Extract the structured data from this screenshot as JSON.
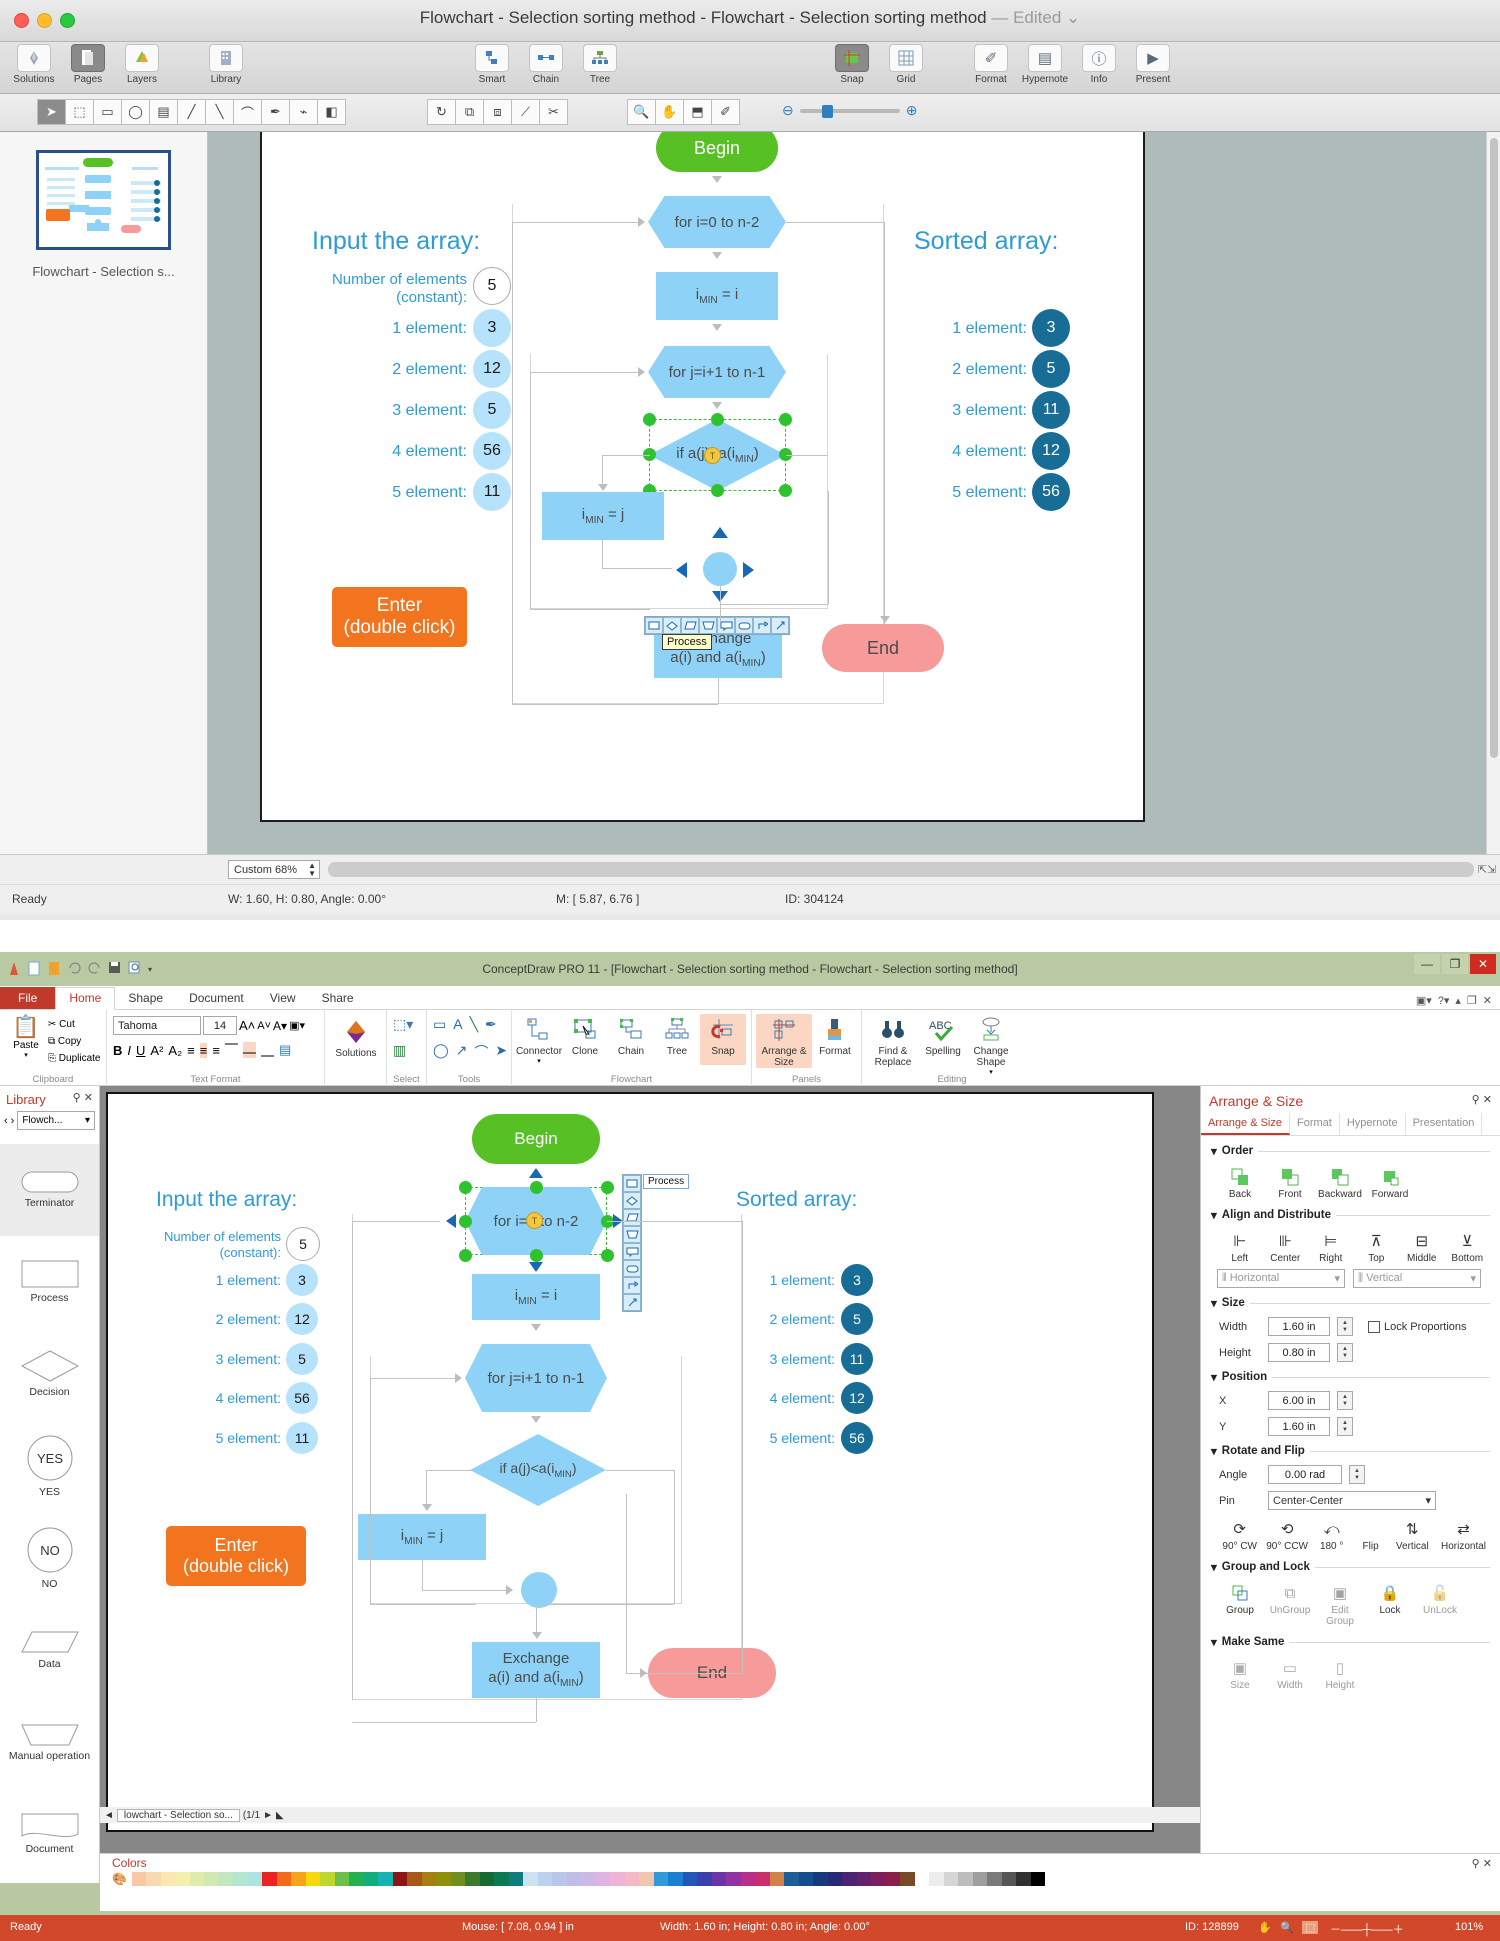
{
  "mac": {
    "title": "Flowchart - Selection sorting method - Flowchart - Selection sorting method",
    "title_dash": "—",
    "edited": "Edited",
    "toolbar_left": [
      {
        "label": "Solutions",
        "icon": "solutions-icon",
        "selected": false
      },
      {
        "label": "Pages",
        "icon": "pages-icon",
        "selected": true
      },
      {
        "label": "Layers",
        "icon": "layers-icon",
        "selected": false
      }
    ],
    "toolbar_library": [
      {
        "label": "Library",
        "icon": "library-icon",
        "selected": false
      }
    ],
    "toolbar_center": [
      {
        "label": "Smart",
        "icon": "smart-icon",
        "selected": false
      },
      {
        "label": "Chain",
        "icon": "chain-icon",
        "selected": false
      },
      {
        "label": "Tree",
        "icon": "tree-icon",
        "selected": false
      }
    ],
    "toolbar_snap": [
      {
        "label": "Snap",
        "icon": "snap-icon",
        "selected": true
      },
      {
        "label": "Grid",
        "icon": "grid-icon",
        "selected": false
      }
    ],
    "toolbar_right": [
      {
        "label": "Format",
        "icon": "format-icon",
        "selected": false
      },
      {
        "label": "Hypernote",
        "icon": "hypernote-icon",
        "selected": false
      },
      {
        "label": "Info",
        "icon": "info-icon",
        "selected": false
      },
      {
        "label": "Present",
        "icon": "present-icon",
        "selected": false
      }
    ],
    "tools_group1": [
      "pointer-icon",
      "text-select-icon",
      "rectangle-icon",
      "ellipse-icon",
      "table-icon",
      "line-icon",
      "diagonal-icon",
      "curve-icon",
      "pen-icon",
      "polyline-icon",
      "door-icon"
    ],
    "tools_group2": [
      "rotate-icon",
      "align-icon",
      "distribute-icon",
      "connector-add-icon",
      "scissors-icon"
    ],
    "tools_group3": [
      "zoom-icon",
      "hand-icon",
      "stamp-icon",
      "eyedropper-icon"
    ],
    "zoom_out_icon": "zoom-out-icon",
    "zoom_in_icon": "zoom-in-icon",
    "sidebar": {
      "page_title": "Flowchart - Selection s..."
    },
    "status": {
      "zoom": "Custom 68%",
      "ready": "Ready",
      "dims": "W: 1.60,  H: 0.80,  Angle: 0.00°",
      "mouse": "M: [ 5.87, 6.76 ]",
      "id": "ID: 304124"
    },
    "canvas": {
      "left_heading": "Input the array:",
      "right_heading": "Sorted array:",
      "const_label_l1": "Number of elements",
      "const_label_l2": "(constant):",
      "const_value": "5",
      "input_rows": [
        {
          "label": "1 element:",
          "value": "3"
        },
        {
          "label": "2 element:",
          "value": "12"
        },
        {
          "label": "3 element:",
          "value": "5"
        },
        {
          "label": "4 element:",
          "value": "56"
        },
        {
          "label": "5 element:",
          "value": "11"
        }
      ],
      "sorted_rows": [
        {
          "label": "1 element:",
          "value": "3"
        },
        {
          "label": "2 element:",
          "value": "5"
        },
        {
          "label": "3 element:",
          "value": "11"
        },
        {
          "label": "4 element:",
          "value": "12"
        },
        {
          "label": "5 element:",
          "value": "56"
        }
      ],
      "enter_l1": "Enter",
      "enter_l2": "(double click)",
      "n_begin": "Begin",
      "n_for_i": "for i=0 to n-2",
      "n_imin_i_a": "i",
      "n_imin_i_b": "MIN",
      "n_imin_i_c": " = i",
      "n_for_j": "for j=i+1 to n-1",
      "n_if_a": "if a(j)<a(i",
      "n_if_b": "MIN",
      "n_if_c": ")",
      "n_imin_j_a": "i",
      "n_imin_j_b": "MIN",
      "n_imin_j_c": " = j",
      "n_exchange_1": "Exchange",
      "n_exchange_2a": "a(i) and a(i",
      "n_exchange_2b": "MIN",
      "n_exchange_2c": ")",
      "n_end": "End",
      "shape_palette": [
        "process-shape-icon",
        "decision-shape-icon",
        "data-shape-icon",
        "manual-op-shape-icon",
        "callout-shape-icon",
        "terminator-shape-icon",
        "connector-elbow-icon",
        "connector-arrow-icon"
      ],
      "tooltip": "Process"
    }
  },
  "win": {
    "title": "ConceptDraw PRO 11 - [Flowchart - Selection sorting method - Flowchart - Selection sorting method]",
    "quick_access": [
      "app-icon",
      "new-icon",
      "open-icon",
      "undo-icon",
      "redo-icon",
      "save-icon",
      "print-preview-icon",
      "qat-dropdown-icon"
    ],
    "window_buttons": [
      "minimize-icon",
      "restore-icon",
      "close-icon"
    ],
    "tabs": [
      {
        "label": "File",
        "kind": "file"
      },
      {
        "label": "Home",
        "kind": "active"
      },
      {
        "label": "Shape",
        "kind": "normal"
      },
      {
        "label": "Document",
        "kind": "normal"
      },
      {
        "label": "View",
        "kind": "normal"
      },
      {
        "label": "Share",
        "kind": "normal"
      }
    ],
    "ribbon_right_icons": [
      "window-layout-icon",
      "help-icon",
      "minimize-ribbon-icon",
      "restore-doc-icon",
      "close-doc-icon"
    ],
    "groups": {
      "clipboard": {
        "name": "Clipboard",
        "paste": "Paste",
        "items": [
          "Cut",
          "Copy",
          "Duplicate"
        ]
      },
      "text_format": {
        "name": "Text Format",
        "font": "Tahoma",
        "size": "14",
        "buttons": [
          "grow-font-icon",
          "shrink-font-icon",
          "font-color-icon",
          "highlight-icon",
          "bold-icon",
          "italic-icon",
          "underline-icon",
          "superscript-icon",
          "subscript-icon",
          "align-left-icon",
          "align-center-icon",
          "align-right-icon",
          "align-top-icon",
          "align-middle-icon",
          "align-bottom-icon",
          "text-block-icon"
        ]
      },
      "solutions": {
        "name": "",
        "label": "Solutions",
        "icon": "solutions-diamond-icon"
      },
      "select": {
        "name": "Select",
        "icons": [
          "select-area-icon",
          "select-all-icon"
        ]
      },
      "tools": {
        "name": "Tools",
        "icons": [
          "rect-tool-icon",
          "text-tool-icon",
          "line-tool-icon",
          "pen-tool-icon",
          "ellipse-tool-icon",
          "arrow-tool-icon",
          "curve-tool-icon",
          "pointer-tool-icon"
        ]
      },
      "flowchart": {
        "name": "Flowchart",
        "items": [
          {
            "label": "Connector",
            "icon": "connector-icon",
            "hl": false
          },
          {
            "label": "Clone",
            "icon": "clone-icon",
            "hl": false
          },
          {
            "label": "Chain",
            "icon": "chain-icon",
            "hl": false
          },
          {
            "label": "Tree",
            "icon": "tree-icon",
            "hl": false
          },
          {
            "label": "Snap",
            "icon": "snap-icon",
            "hl": true
          }
        ]
      },
      "panels": {
        "name": "Panels",
        "items": [
          {
            "label": "Arrange & Size",
            "icon": "arrange-size-icon",
            "hl": true
          },
          {
            "label": "Format",
            "icon": "format-brush-icon",
            "hl": false
          }
        ]
      },
      "editing": {
        "name": "Editing",
        "items": [
          {
            "label": "Find & Replace",
            "icon": "find-replace-icon",
            "hl": false
          },
          {
            "label": "Spelling",
            "icon": "spelling-icon",
            "hl": false
          },
          {
            "label": "Change Shape",
            "icon": "change-shape-icon",
            "hl": false
          }
        ]
      }
    },
    "library": {
      "title": "Library",
      "pin_icon": "pin-icon",
      "close_icon": "close-icon",
      "prev_icon": "prev-icon",
      "next_icon": "next-icon",
      "dropdown": "Flowch...",
      "items": [
        {
          "name": "Terminator",
          "shape": "terminator",
          "selected": true
        },
        {
          "name": "Process",
          "shape": "process",
          "selected": false
        },
        {
          "name": "Decision",
          "shape": "decision",
          "selected": false
        },
        {
          "name": "YES",
          "shape": "circle",
          "text": "YES",
          "selected": false
        },
        {
          "name": "NO",
          "shape": "circle",
          "text": "NO",
          "selected": false
        },
        {
          "name": "Data",
          "shape": "data",
          "selected": false
        },
        {
          "name": "Manual operation",
          "shape": "manual",
          "selected": false
        },
        {
          "name": "Document",
          "shape": "document",
          "selected": false
        }
      ]
    },
    "arrange": {
      "title": "Arrange & Size",
      "pin_icon": "pin-icon",
      "close_icon": "close-icon",
      "tabs": [
        "Arrange & Size",
        "Format",
        "Hypernote",
        "Presentation"
      ],
      "order": {
        "title": "Order",
        "items": [
          "Back",
          "Front",
          "Backward",
          "Forward"
        ]
      },
      "align": {
        "title": "Align and Distribute",
        "items": [
          "Left",
          "Center",
          "Right",
          "Top",
          "Middle",
          "Bottom"
        ],
        "horizontal": "Horizontal",
        "vertical": "Vertical"
      },
      "size": {
        "title": "Size",
        "width_label": "Width",
        "width_value": "1.60 in",
        "height_label": "Height",
        "height_value": "0.80 in",
        "lock_label": "Lock Proportions"
      },
      "position": {
        "title": "Position",
        "x_label": "X",
        "x_value": "6.00 in",
        "y_label": "Y",
        "y_value": "1.60 in"
      },
      "rotate": {
        "title": "Rotate and Flip",
        "angle_label": "Angle",
        "angle_value": "0.00 rad",
        "pin_label": "Pin",
        "pin_value": "Center-Center",
        "items": [
          "90° CW",
          "90° CCW",
          "180 °"
        ],
        "flip_label": "Flip",
        "flip_items": [
          "Vertical",
          "Horizontal"
        ]
      },
      "group": {
        "title": "Group and Lock",
        "items": [
          "Group",
          "UnGroup",
          "Edit Group",
          "Lock",
          "UnLock"
        ]
      },
      "same": {
        "title": "Make Same",
        "items": [
          "Size",
          "Width",
          "Height"
        ]
      }
    },
    "colors_panel": {
      "title": "Colors",
      "pin_icon": "pin-icon",
      "close_icon": "close-icon"
    },
    "doc_tab": "lowchart - Selection so...",
    "doc_page": "(1/1",
    "status": {
      "ready": "Ready",
      "mouse": "Mouse: [ 7.08, 0.94 ] in",
      "dims": "Width: 1.60 in; Height: 0.80 in; Angle: 0.00°",
      "id": "ID: 128899",
      "zoom": "101%"
    },
    "canvas": {
      "left_heading": "Input the array:",
      "right_heading": "Sorted array:",
      "const_label_l1": "Number of elements",
      "const_label_l2": "(constant):",
      "const_value": "5",
      "input_rows": [
        {
          "label": "1 element:",
          "value": "3"
        },
        {
          "label": "2 element:",
          "value": "12"
        },
        {
          "label": "3 element:",
          "value": "5"
        },
        {
          "label": "4 element:",
          "value": "56"
        },
        {
          "label": "5 element:",
          "value": "11"
        }
      ],
      "sorted_rows": [
        {
          "label": "1 element:",
          "value": "3"
        },
        {
          "label": "2 element:",
          "value": "5"
        },
        {
          "label": "3 element:",
          "value": "11"
        },
        {
          "label": "4 element:",
          "value": "12"
        },
        {
          "label": "5 element:",
          "value": "56"
        }
      ],
      "enter_l1": "Enter",
      "enter_l2": "(double click)",
      "n_begin": "Begin",
      "n_for_i": "for i=0 to n-2",
      "n_imin_i": "i",
      "n_imin_i_sub": "MIN",
      "n_imin_i_rest": " = i",
      "n_for_j": "for j=i+1 to n-1",
      "n_if_a": "if a(j)<a(i",
      "n_if_b": "MIN",
      "n_if_c": ")",
      "n_imin_j": "i",
      "n_imin_j_sub": "MIN",
      "n_imin_j_rest": " = j",
      "n_exchange_1": "Exchange",
      "n_exchange_2a": "a(i) and a(i",
      "n_exchange_2b": "MIN",
      "n_exchange_2c": ")",
      "n_end": "End",
      "shape_palette": [
        "process-shape-icon",
        "decision-shape-icon",
        "data-shape-icon",
        "manual-op-shape-icon",
        "callout-shape-icon",
        "terminator-shape-icon",
        "connector-elbow-icon",
        "connector-arrow-icon"
      ],
      "tooltip": "Process"
    }
  },
  "colors": {
    "accent_blue": "#2d9bd8",
    "shape_blue": "#8ed2f7",
    "begin_green": "#56c024",
    "end_pink": "#f79a9a",
    "enter_orange": "#f2741e",
    "dark_badge": "#186d96",
    "win_status_red": "#d1492a",
    "ribbon_highlight": "#fbd6c3"
  },
  "palette_swatches": [
    "#f8c9a4",
    "#fbd9b0",
    "#fbe8b0",
    "#f3f0ae",
    "#e0eda8",
    "#cfe9b0",
    "#bfe8c3",
    "#b4e6d4",
    "#aee3e3",
    "#ee2222",
    "#f36a1e",
    "#f7a41c",
    "#f5d90a",
    "#bed62e",
    "#6cc04a",
    "#22b14c",
    "#0fae7a",
    "#17b2b2",
    "#8e1515",
    "#a8561a",
    "#a87d12",
    "#8f8f0a",
    "#6f8f1e",
    "#3e7a2e",
    "#176b31",
    "#0a7a55",
    "#0e7d7d",
    "#cfe0f3",
    "#bcd3ef",
    "#b7c6ea",
    "#c0bde8",
    "#cdb8e6",
    "#dfb4e2",
    "#edb4d6",
    "#f6b9c3",
    "#f4c5ad",
    "#2f9bd8",
    "#1a7fd0",
    "#2356b8",
    "#3c3fae",
    "#6b35a8",
    "#9231a0",
    "#b82f89",
    "#cb2f6a",
    "#d2814a",
    "#1b5f96",
    "#134e8e",
    "#17397e",
    "#282a78",
    "#4a2372",
    "#65226c",
    "#7d1f5c",
    "#8c1f48",
    "#7a4a26",
    "#ffffff",
    "#ededed",
    "#d6d6d6",
    "#bdbdbd",
    "#9e9e9e",
    "#7a7a7a",
    "#565656",
    "#303030",
    "#000000"
  ]
}
